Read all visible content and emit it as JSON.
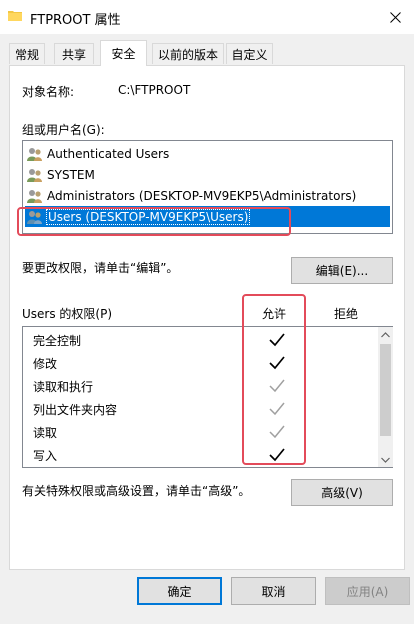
{
  "window": {
    "title": "FTPROOT 属性",
    "title_icon": "folder-icon",
    "close_icon": "close-icon"
  },
  "tabs": [
    {
      "label": "常规",
      "active": false
    },
    {
      "label": "共享",
      "active": false
    },
    {
      "label": "安全",
      "active": true
    },
    {
      "label": "以前的版本",
      "active": false
    },
    {
      "label": "自定义",
      "active": false
    }
  ],
  "object": {
    "label": "对象名称:",
    "value": "C:\\FTPROOT"
  },
  "groups": {
    "label": "组或用户名(G):",
    "items": [
      {
        "name": "Authenticated Users",
        "icon": "user-group-icon",
        "selected": false
      },
      {
        "name": "SYSTEM",
        "icon": "user-group-icon",
        "selected": false
      },
      {
        "name": "Administrators (DESKTOP-MV9EKP5\\Administrators)",
        "icon": "user-group-icon",
        "selected": false
      },
      {
        "name": "Users (DESKTOP-MV9EKP5\\Users)",
        "icon": "user-group-icon",
        "selected": true
      }
    ]
  },
  "edit": {
    "hint": "要更改权限，请单击“编辑”。",
    "button": "编辑(E)..."
  },
  "permissions": {
    "label": "Users 的权限(P)",
    "allow_header": "允许",
    "deny_header": "拒绝",
    "items": [
      {
        "name": "完全控制",
        "allow": true,
        "inherited": false
      },
      {
        "name": "修改",
        "allow": true,
        "inherited": false
      },
      {
        "name": "读取和执行",
        "allow": true,
        "inherited": true
      },
      {
        "name": "列出文件夹内容",
        "allow": true,
        "inherited": true
      },
      {
        "name": "读取",
        "allow": true,
        "inherited": true
      },
      {
        "name": "写入",
        "allow": true,
        "inherited": false
      }
    ]
  },
  "advanced": {
    "hint": "有关特殊权限或高级设置，请单击“高级”。",
    "button": "高级(V)"
  },
  "footer": {
    "ok": "确定",
    "cancel": "取消",
    "apply": "应用(A)"
  },
  "colors": {
    "selection": "#0078d7",
    "highlight_annotation": "#e34b5a",
    "check_active": "#000000",
    "check_inherited": "#a0a0a0"
  }
}
